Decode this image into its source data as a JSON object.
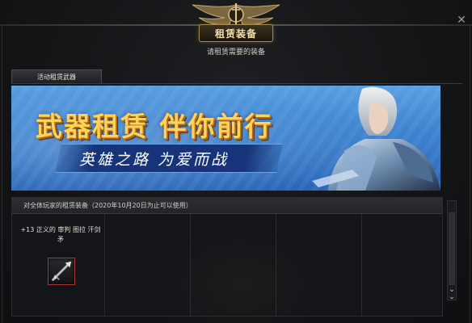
{
  "window": {
    "title": "租赁装备",
    "subtitle": "请租赁需要的装备",
    "close_icon": "close-icon",
    "accent_gold": "#c8a86a"
  },
  "tabs": [
    {
      "label": "活动租赁武器",
      "active": true
    }
  ],
  "banner": {
    "headline": "武器租赁 伴你前行",
    "tagline": "英雄之路 为爱而战",
    "background_color": "#3f86d2",
    "headline_color": "#ffd35a"
  },
  "rental_panel": {
    "header": "对全体玩家的租赁装备（2020年10月20日为止可以使用）",
    "items": [
      {
        "name": "+13 正义的 审判 图拉 汗剑矛",
        "icon": "spear-icon"
      }
    ]
  },
  "scrollbar": {
    "down_icon": "chevron-down-icon"
  }
}
